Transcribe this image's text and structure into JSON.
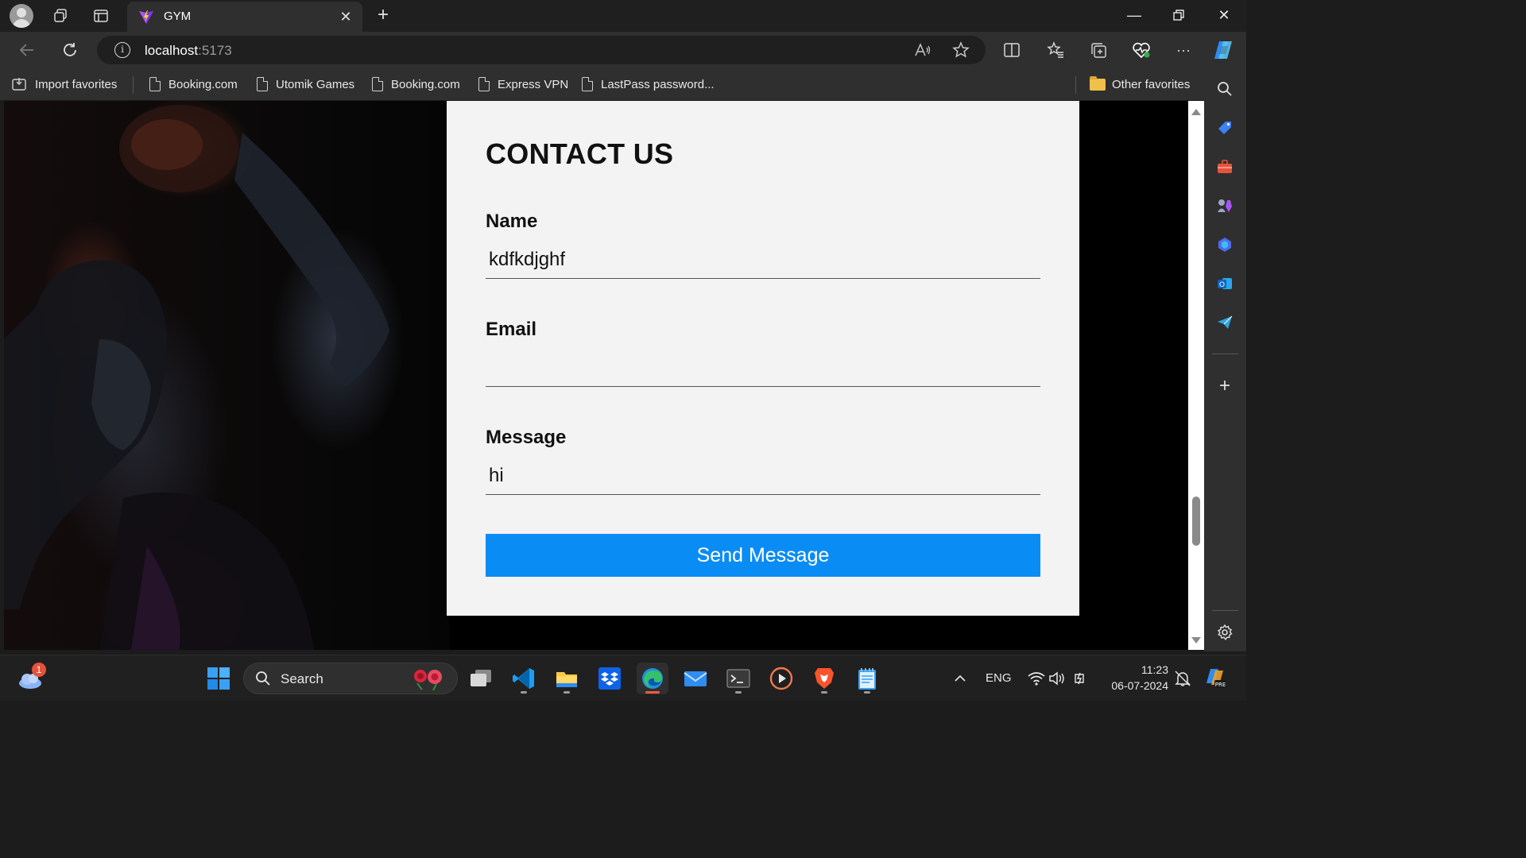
{
  "browser": {
    "tab": {
      "title": "GYM"
    },
    "address": {
      "host": "localhost",
      "port": ":5173"
    },
    "favorites": [
      {
        "label": "Import favorites"
      },
      {
        "label": "Booking.com"
      },
      {
        "label": "Utomik Games"
      },
      {
        "label": "Booking.com"
      },
      {
        "label": "Express VPN"
      },
      {
        "label": "LastPass password..."
      }
    ],
    "other_favorites": "Other favorites"
  },
  "page": {
    "title": "CONTACT US",
    "form": {
      "name_label": "Name",
      "name_value": "kdfkdjghf",
      "email_label": "Email",
      "email_value": "",
      "message_label": "Message",
      "message_value": "hi",
      "submit_label": "Send Message"
    }
  },
  "taskbar": {
    "search_label": "Search",
    "weather_badge": "1",
    "language": "ENG",
    "time": "11:23",
    "date": "06-07-2024"
  },
  "colors": {
    "accent_button": "#0a8cf5",
    "card_bg": "#f3f3f3",
    "browser_bg": "#2f2f2f"
  }
}
